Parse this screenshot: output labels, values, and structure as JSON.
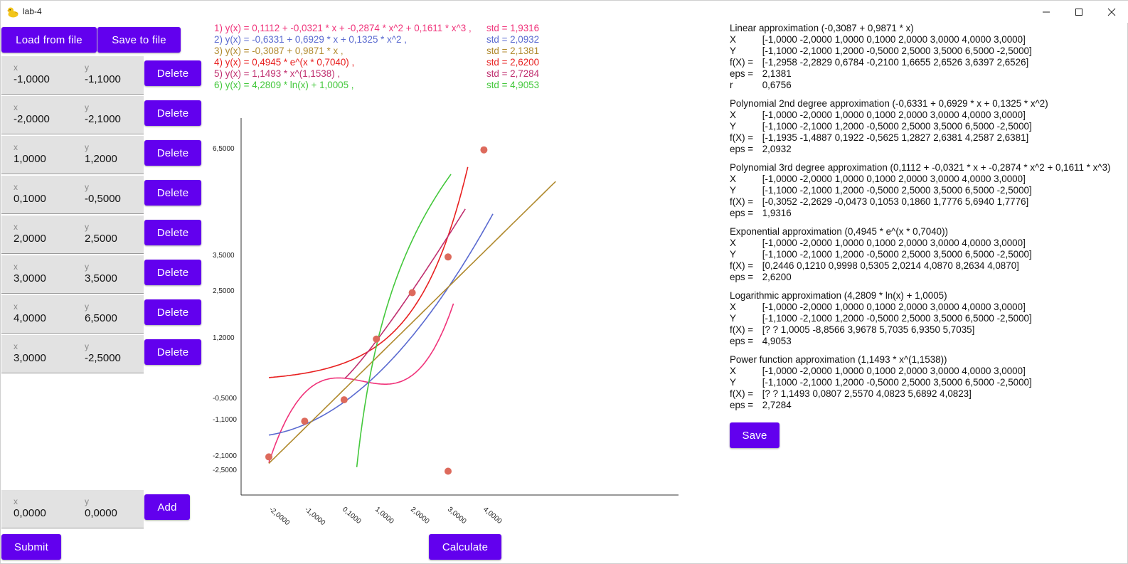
{
  "window": {
    "title": "lab-4",
    "app_icon": "duck-icon",
    "controls": [
      "minimize-icon",
      "maximize-icon",
      "close-icon"
    ]
  },
  "toolbar": {
    "load_label": "Load from file",
    "save_label": "Save to file"
  },
  "points": [
    {
      "x_label": "x",
      "x": "-1,0000",
      "y_label": "y",
      "y": "-1,1000",
      "delete_label": "Delete"
    },
    {
      "x_label": "x",
      "x": "-2,0000",
      "y_label": "y",
      "y": "-2,1000",
      "delete_label": "Delete"
    },
    {
      "x_label": "x",
      "x": "1,0000",
      "y_label": "y",
      "y": "1,2000",
      "delete_label": "Delete"
    },
    {
      "x_label": "x",
      "x": "0,1000",
      "y_label": "y",
      "y": "-0,5000",
      "delete_label": "Delete"
    },
    {
      "x_label": "x",
      "x": "2,0000",
      "y_label": "y",
      "y": "2,5000",
      "delete_label": "Delete"
    },
    {
      "x_label": "x",
      "x": "3,0000",
      "y_label": "y",
      "y": "3,5000",
      "delete_label": "Delete"
    },
    {
      "x_label": "x",
      "x": "4,0000",
      "y_label": "y",
      "y": "6,5000",
      "delete_label": "Delete"
    },
    {
      "x_label": "x",
      "x": "3,0000",
      "y_label": "y",
      "y": "-2,5000",
      "delete_label": "Delete"
    }
  ],
  "new_point": {
    "x_label": "x",
    "x": "0,0000",
    "y_label": "y",
    "y": "0,0000",
    "add_label": "Add"
  },
  "actions": {
    "submit_label": "Submit",
    "calculate_label": "Calculate",
    "save_label": "Save"
  },
  "equations": [
    {
      "text": "1) y(x) = 0,1112 + -0,0321 * x + -0,2874 * x^2 + 0,1611 * x^3 ,",
      "std": "std = 1,9316",
      "color": "#f0337a"
    },
    {
      "text": "2) y(x) = -0,6331 + 0,6929 * x + 0,1325 * x^2 ,",
      "std": "std = 2,0932",
      "color": "#5a6ad0"
    },
    {
      "text": "3) y(x) = -0,3087 + 0,9871 * x ,",
      "std": "std = 2,1381",
      "color": "#b08a2e"
    },
    {
      "text": "4) y(x) = 0,4945 * e^(x * 0,7040) ,",
      "std": "std = 2,6200",
      "color": "#e82020"
    },
    {
      "text": "5) y(x) = 1,1493 * x^(1,1538) ,",
      "std": "std = 2,7284",
      "color": "#c03070"
    },
    {
      "text": "6) y(x) = 4,2809 * ln(x) + 1,0005 ,",
      "std": "std = 4,9053",
      "color": "#44c83c"
    }
  ],
  "chart_data": {
    "type": "scatter",
    "x_tick_labels": [
      "-2,0000",
      "-1,0000",
      "0,1000",
      "1,0000",
      "2,0000",
      "3,0000",
      "4,0000"
    ],
    "y_tick_labels": [
      "6,5000",
      "3,5000",
      "2,5000",
      "1,2000",
      "-0,5000",
      "-1,1000",
      "-2,1000",
      "-2,5000"
    ],
    "points": [
      {
        "x": -1.0,
        "y": -1.1
      },
      {
        "x": -2.0,
        "y": -2.1
      },
      {
        "x": 1.0,
        "y": 1.2
      },
      {
        "x": 0.1,
        "y": -0.5
      },
      {
        "x": 2.0,
        "y": 2.5
      },
      {
        "x": 3.0,
        "y": 3.5
      },
      {
        "x": 4.0,
        "y": 6.5
      },
      {
        "x": 3.0,
        "y": -2.5
      }
    ],
    "point_color": "#dd6a5c",
    "series": [
      {
        "kind": "cubic",
        "coef": [
          0.1112,
          -0.0321,
          -0.2874,
          0.1611
        ],
        "color": "#f0337a"
      },
      {
        "kind": "quadratic",
        "coef": [
          -0.6331,
          0.6929,
          0.1325
        ],
        "color": "#5a6ad0"
      },
      {
        "kind": "linear",
        "coef": [
          -0.3087,
          0.9871
        ],
        "color": "#b08a2e"
      },
      {
        "kind": "exponential",
        "coef": [
          0.4945,
          0.704
        ],
        "color": "#e82020"
      },
      {
        "kind": "power",
        "coef": [
          1.1493,
          1.1538
        ],
        "color": "#c03070"
      },
      {
        "kind": "logarithmic",
        "coef": [
          4.2809,
          1.0005
        ],
        "color": "#44c83c"
      }
    ],
    "x_range": [
      -2.0,
      7.0
    ],
    "y_range": [
      -2.1,
      6.5
    ]
  },
  "results": [
    {
      "title": "Linear approximation (-0,3087 + 0,9871 * x)",
      "lines": [
        {
          "k": "X",
          "v": "[-1,0000 -2,0000 1,0000 0,1000 2,0000 3,0000 4,0000 3,0000]"
        },
        {
          "k": "Y",
          "v": "[-1,1000 -2,1000 1,2000 -0,5000 2,5000 3,5000 6,5000 -2,5000]"
        },
        {
          "k": "f(X) =",
          "v": "[-1,2958 -2,2829 0,6784 -0,2100 1,6655 2,6526 3,6397 2,6526]"
        },
        {
          "k": "eps =",
          "v": "2,1381"
        },
        {
          "k": "r",
          "v": "0,6756"
        }
      ]
    },
    {
      "title": "Polynomial 2nd degree approximation (-0,6331 + 0,6929 * x + 0,1325 * x^2)",
      "lines": [
        {
          "k": "X",
          "v": "[-1,0000 -2,0000 1,0000 0,1000 2,0000 3,0000 4,0000 3,0000]"
        },
        {
          "k": "Y",
          "v": "[-1,1000 -2,1000 1,2000 -0,5000 2,5000 3,5000 6,5000 -2,5000]"
        },
        {
          "k": "f(X) =",
          "v": "[-1,1935 -1,4887 0,1922 -0,5625 1,2827 2,6381 4,2587 2,6381]"
        },
        {
          "k": "eps =",
          "v": "2,0932"
        }
      ]
    },
    {
      "title": "Polynomial 3rd degree approximation (0,1112 + -0,0321 * x + -0,2874 * x^2 + 0,1611 * x^3)",
      "lines": [
        {
          "k": "X",
          "v": "[-1,0000 -2,0000 1,0000 0,1000 2,0000 3,0000 4,0000 3,0000]"
        },
        {
          "k": "Y",
          "v": "[-1,1000 -2,1000 1,2000 -0,5000 2,5000 3,5000 6,5000 -2,5000]"
        },
        {
          "k": "f(X) =",
          "v": "[-0,3052 -2,2629 -0,0473 0,1053 0,1860 1,7776 5,6940 1,7776]"
        },
        {
          "k": "eps =",
          "v": "1,9316"
        }
      ]
    },
    {
      "title": "Exponential approximation (0,4945 * e^(x * 0,7040))",
      "lines": [
        {
          "k": "X",
          "v": "[-1,0000 -2,0000 1,0000 0,1000 2,0000 3,0000 4,0000 3,0000]"
        },
        {
          "k": "Y",
          "v": "[-1,1000 -2,1000 1,2000 -0,5000 2,5000 3,5000 6,5000 -2,5000]"
        },
        {
          "k": "f(X) =",
          "v": "[0,2446 0,1210 0,9998 0,5305 2,0214 4,0870 8,2634 4,0870]"
        },
        {
          "k": "eps =",
          "v": "2,6200"
        }
      ]
    },
    {
      "title": "Logarithmic approximation (4,2809 * ln(x) + 1,0005)",
      "lines": [
        {
          "k": "X",
          "v": "[-1,0000 -2,0000 1,0000 0,1000 2,0000 3,0000 4,0000 3,0000]"
        },
        {
          "k": "Y",
          "v": "[-1,1000 -2,1000 1,2000 -0,5000 2,5000 3,5000 6,5000 -2,5000]"
        },
        {
          "k": "f(X) =",
          "v": "[? ? 1,0005 -8,8566 3,9678 5,7035 6,9350 5,7035]"
        },
        {
          "k": "eps =",
          "v": "4,9053"
        }
      ]
    },
    {
      "title": "Power function approximation (1,1493 * x^(1,1538))",
      "lines": [
        {
          "k": "X",
          "v": "[-1,0000 -2,0000 1,0000 0,1000 2,0000 3,0000 4,0000 3,0000]"
        },
        {
          "k": "Y",
          "v": "[-1,1000 -2,1000 1,2000 -0,5000 2,5000 3,5000 6,5000 -2,5000]"
        },
        {
          "k": "f(X) =",
          "v": "[? ? 1,1493 0,0807 2,5570 4,0823 5,6892 4,0823]"
        },
        {
          "k": "eps =",
          "v": "2,7284"
        }
      ]
    }
  ]
}
